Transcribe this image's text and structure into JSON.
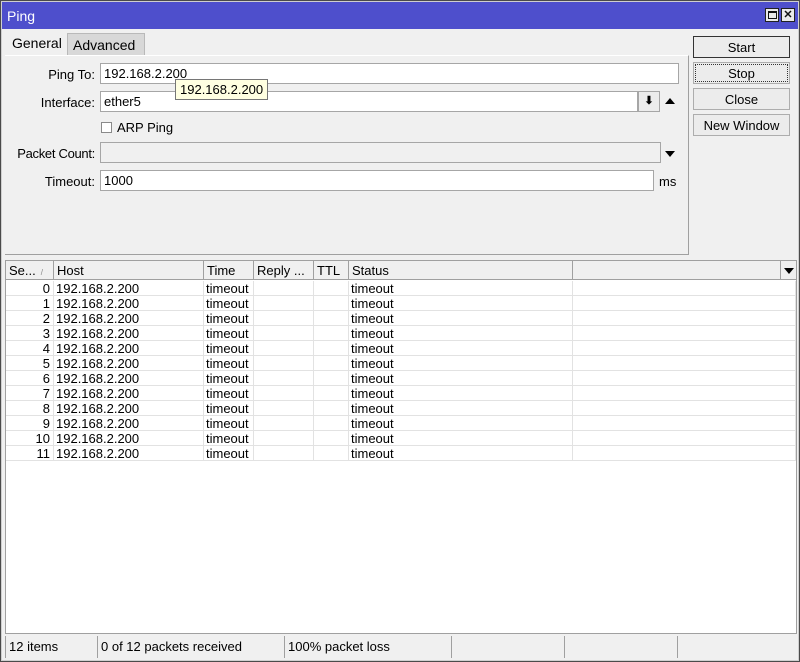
{
  "window": {
    "title": "Ping",
    "controls": {
      "maximize": "maximize-icon",
      "close": "close-icon"
    }
  },
  "tabs": [
    {
      "label": "General",
      "active": true
    },
    {
      "label": "Advanced",
      "active": false
    }
  ],
  "form": {
    "ping_to": {
      "label": "Ping To:",
      "value": "192.168.2.200"
    },
    "interface": {
      "label": "Interface:",
      "value": "ether5"
    },
    "arp_ping": {
      "label": "ARP Ping",
      "checked": false
    },
    "packet_count": {
      "label": "Packet Count:",
      "value": ""
    },
    "timeout": {
      "label": "Timeout:",
      "value": "1000",
      "unit": "ms"
    }
  },
  "tooltip": {
    "text": "192.168.2.200"
  },
  "buttons": {
    "start": "Start",
    "stop": "Stop",
    "close": "Close",
    "new_window": "New Window"
  },
  "table": {
    "columns": [
      "Se...",
      "Host",
      "Time",
      "Reply ...",
      "TTL",
      "Status"
    ],
    "sort_indicator": "/",
    "rows": [
      {
        "seq": "0",
        "host": "192.168.2.200",
        "time": "timeout",
        "reply": "",
        "ttl": "",
        "status": "timeout"
      },
      {
        "seq": "1",
        "host": "192.168.2.200",
        "time": "timeout",
        "reply": "",
        "ttl": "",
        "status": "timeout"
      },
      {
        "seq": "2",
        "host": "192.168.2.200",
        "time": "timeout",
        "reply": "",
        "ttl": "",
        "status": "timeout"
      },
      {
        "seq": "3",
        "host": "192.168.2.200",
        "time": "timeout",
        "reply": "",
        "ttl": "",
        "status": "timeout"
      },
      {
        "seq": "4",
        "host": "192.168.2.200",
        "time": "timeout",
        "reply": "",
        "ttl": "",
        "status": "timeout"
      },
      {
        "seq": "5",
        "host": "192.168.2.200",
        "time": "timeout",
        "reply": "",
        "ttl": "",
        "status": "timeout"
      },
      {
        "seq": "6",
        "host": "192.168.2.200",
        "time": "timeout",
        "reply": "",
        "ttl": "",
        "status": "timeout"
      },
      {
        "seq": "7",
        "host": "192.168.2.200",
        "time": "timeout",
        "reply": "",
        "ttl": "",
        "status": "timeout"
      },
      {
        "seq": "8",
        "host": "192.168.2.200",
        "time": "timeout",
        "reply": "",
        "ttl": "",
        "status": "timeout"
      },
      {
        "seq": "9",
        "host": "192.168.2.200",
        "time": "timeout",
        "reply": "",
        "ttl": "",
        "status": "timeout"
      },
      {
        "seq": "10",
        "host": "192.168.2.200",
        "time": "timeout",
        "reply": "",
        "ttl": "",
        "status": "timeout"
      },
      {
        "seq": "11",
        "host": "192.168.2.200",
        "time": "timeout",
        "reply": "",
        "ttl": "",
        "status": "timeout"
      }
    ]
  },
  "statusbar": {
    "items": "12 items",
    "received": "0 of 12 packets received",
    "loss": "100% packet loss"
  },
  "colors": {
    "titlebar": "#4e4fcc",
    "background": "#f0f0f0",
    "tooltip": "#ffffe1"
  }
}
